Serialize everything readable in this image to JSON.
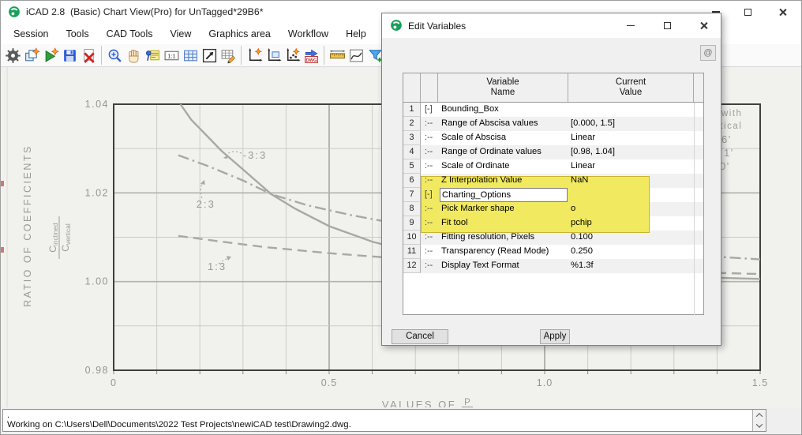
{
  "window": {
    "title": "iCAD 2.8  (Basic) Chart View(Pro) for UnTagged*29B6*",
    "app_icon": "icad-green-logo",
    "controls": [
      "minimize-button",
      "maximize-button",
      "close-button"
    ]
  },
  "menu": {
    "items": [
      {
        "label": "Session"
      },
      {
        "label": "Tools"
      },
      {
        "label": "CAD Tools"
      },
      {
        "label": "View"
      },
      {
        "label": "Graphics area"
      },
      {
        "label": "Workflow"
      },
      {
        "label": "Help"
      }
    ]
  },
  "toolbar": {
    "groups": [
      {
        "icons": [
          "settings-gear",
          "copy-objects",
          "run-workflow",
          "save",
          "delete-red-x"
        ]
      },
      {
        "icons": [
          "zoom-in",
          "pan-hand",
          "annotate-note",
          "actual-size-1-1",
          "grid-toggle",
          "fit-extents",
          "edit-table"
        ]
      },
      {
        "icons": [
          "new-chart",
          "chart-region",
          "chart-points",
          "export-dwg"
        ]
      },
      {
        "icons": [
          "measure-ruler",
          "fit-curve",
          "filter-add",
          "snap-center"
        ]
      }
    ]
  },
  "dialog": {
    "title": "Edit Variables",
    "at_button": "@",
    "controls": [
      "dialog-minimize-button",
      "dialog-maximize-button",
      "dialog-close-button"
    ],
    "table": {
      "headers": {
        "name_line1": "Variable",
        "name_line2": "Name",
        "value_line1": "Current",
        "value_line2": "Value"
      },
      "rows": [
        {
          "num": "1",
          "prefix": "[-]",
          "name": "Bounding_Box",
          "value": ""
        },
        {
          "num": "2",
          "prefix": ":--",
          "name": "Range of Abscisa values",
          "value": "[0.000, 1.5]",
          "highlight": true
        },
        {
          "num": "3",
          "prefix": ":--",
          "name": "Scale of Abscisa",
          "value": "Linear",
          "highlight": true
        },
        {
          "num": "4",
          "prefix": ":--",
          "name": "Range of Ordinate values",
          "value": "[0.98, 1.04]",
          "highlight": true
        },
        {
          "num": "5",
          "prefix": ":--",
          "name": "Scale of Ordinate",
          "value": "Linear",
          "highlight": true
        },
        {
          "num": "6",
          "prefix": ":--",
          "name": "Z Interpolation Value",
          "value": "NaN"
        },
        {
          "num": "7",
          "prefix": "[-]",
          "name": "Charting_Options",
          "value": "",
          "caret": true,
          "selected": true
        },
        {
          "num": "8",
          "prefix": ":--",
          "name": "Pick Marker shape",
          "value": "o"
        },
        {
          "num": "9",
          "prefix": ":--",
          "name": "Fit tool",
          "value": "pchip"
        },
        {
          "num": "10",
          "prefix": ":--",
          "name": "Fitting resolution, Pixels",
          "value": "0.100"
        },
        {
          "num": "11",
          "prefix": ":--",
          "name": "Transparency (Read Mode)",
          "value": "0.250"
        },
        {
          "num": "12",
          "prefix": ":--",
          "name": "Display Text Format",
          "value": "%1.3f"
        }
      ]
    },
    "cancel_label": "Cancel",
    "apply_label": "Apply",
    "highlight_color": "#f1ea60"
  },
  "statusbar": {
    "lines": [
      ".",
      "Working on C:\\Users\\Dell\\Documents\\2022 Test Projects\\newiCAD test\\Drawing2.dwg."
    ]
  },
  "chart_data": {
    "type": "line",
    "title": "",
    "xlabel_prefix": "VALUES OF",
    "xlabel_fraction_numerator": "P",
    "ylabel": "RATIO OF COEFFICIENTS",
    "ylabel_fraction": {
      "numerator": "C",
      "numerator_sub": "inclined",
      "denominator": "C",
      "denominator_sub": "vertical"
    },
    "xlim": [
      0,
      1.5
    ],
    "ylim": [
      0.98,
      1.04
    ],
    "x_ticks": [
      0,
      0.5,
      1.0,
      1.5
    ],
    "x_tick_labels": [
      "0",
      "0.5",
      "1.0",
      "1.5"
    ],
    "y_ticks": [
      0.98,
      1.0,
      1.02,
      1.04
    ],
    "y_tick_labels": [
      "0.98",
      "1.00",
      "1.02",
      "1.04"
    ],
    "x_grid_step": 0.1,
    "y_grid_step": 0.01,
    "grid": true,
    "legend_position": "none",
    "series": [
      {
        "name": "3:3",
        "style": "solid",
        "points": [
          [
            0.155,
            1.04
          ],
          [
            0.18,
            1.0365
          ],
          [
            0.21,
            1.0335
          ],
          [
            0.25,
            1.0295
          ],
          [
            0.3,
            1.0253
          ],
          [
            0.366,
            1.0197
          ],
          [
            0.42,
            1.0165
          ],
          [
            0.5,
            1.0125
          ],
          [
            0.6,
            1.009
          ],
          [
            0.7,
            1.0065
          ],
          [
            0.85,
            1.0042
          ],
          [
            1.0,
            1.0028
          ],
          [
            1.2,
            1.0016
          ],
          [
            1.35,
            1.001
          ],
          [
            1.5,
            1.0006
          ]
        ]
      },
      {
        "name": "2:3",
        "style": "dash-dot",
        "points": [
          [
            0.15,
            1.0285
          ],
          [
            0.22,
            1.026
          ],
          [
            0.3,
            1.0228
          ],
          [
            0.366,
            1.0197
          ],
          [
            0.45,
            1.0172
          ],
          [
            0.55,
            1.015
          ],
          [
            0.65,
            1.0132
          ],
          [
            0.8,
            1.011
          ],
          [
            0.95,
            1.0092
          ],
          [
            1.1,
            1.0078
          ],
          [
            1.3,
            1.0062
          ],
          [
            1.5,
            1.005
          ]
        ]
      },
      {
        "name": "1:3",
        "style": "dashed",
        "points": [
          [
            0.15,
            1.0103
          ],
          [
            0.25,
            1.009
          ],
          [
            0.35,
            1.0078
          ],
          [
            0.5,
            1.0064
          ],
          [
            0.65,
            1.0053
          ],
          [
            0.8,
            1.0044
          ],
          [
            1.0,
            1.0034
          ],
          [
            1.2,
            1.0026
          ],
          [
            1.35,
            1.0021
          ],
          [
            1.5,
            1.0017
          ]
        ]
      }
    ],
    "series_labels": [
      {
        "text": "-3:3",
        "x": 0.3,
        "y": 1.0284
      },
      {
        "text": "2:3",
        "x": 0.192,
        "y": 1.0174
      },
      {
        "text": "1:3",
        "x": 0.218,
        "y": 1.0033
      }
    ],
    "right_margin_fragments": [
      "with",
      "rtical",
      "6'",
      "1'",
      "0'"
    ]
  }
}
